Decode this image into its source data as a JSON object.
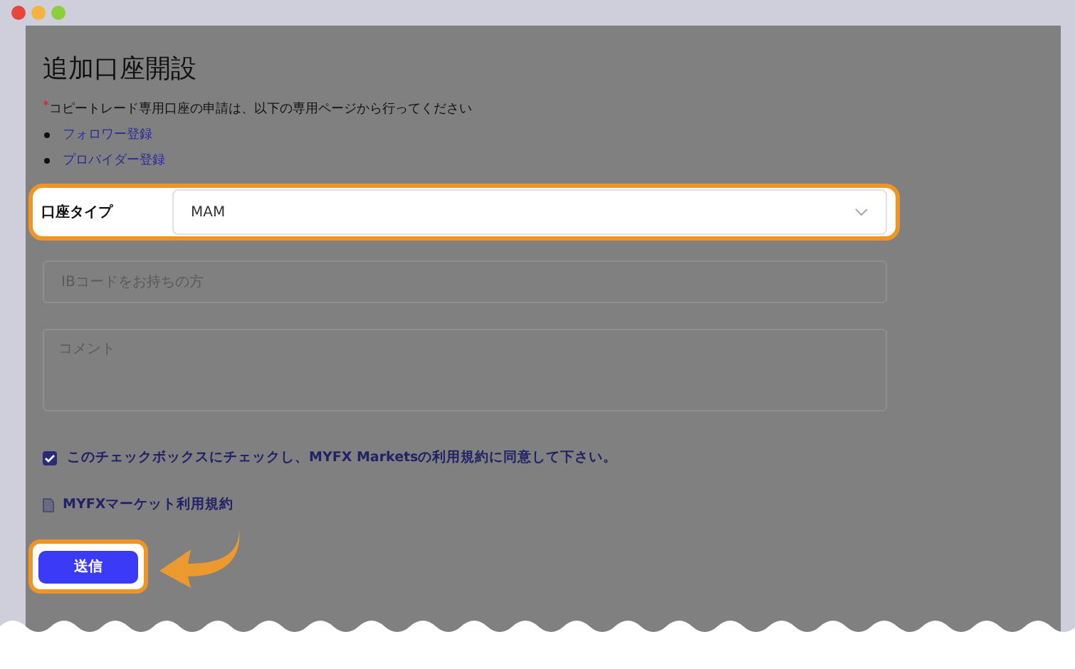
{
  "title": "追加口座開設",
  "note": {
    "required_mark": "*",
    "text": "コピートレード専用口座の申請は、以下の専用ページから行ってください"
  },
  "links": [
    {
      "label": "フォロワー登録"
    },
    {
      "label": "プロバイダー登録"
    }
  ],
  "account_type": {
    "label": "口座タイプ",
    "value": "MAM"
  },
  "ib_code": {
    "placeholder": "IBコードをお持ちの方"
  },
  "comment": {
    "placeholder": "コメント"
  },
  "agree": {
    "checked": true,
    "label": "このチェックボックスにチェックし、MYFX Marketsの利用規約に同意して下さい。"
  },
  "terms_link": "MYFXマーケット利用規約",
  "submit": "送信"
}
